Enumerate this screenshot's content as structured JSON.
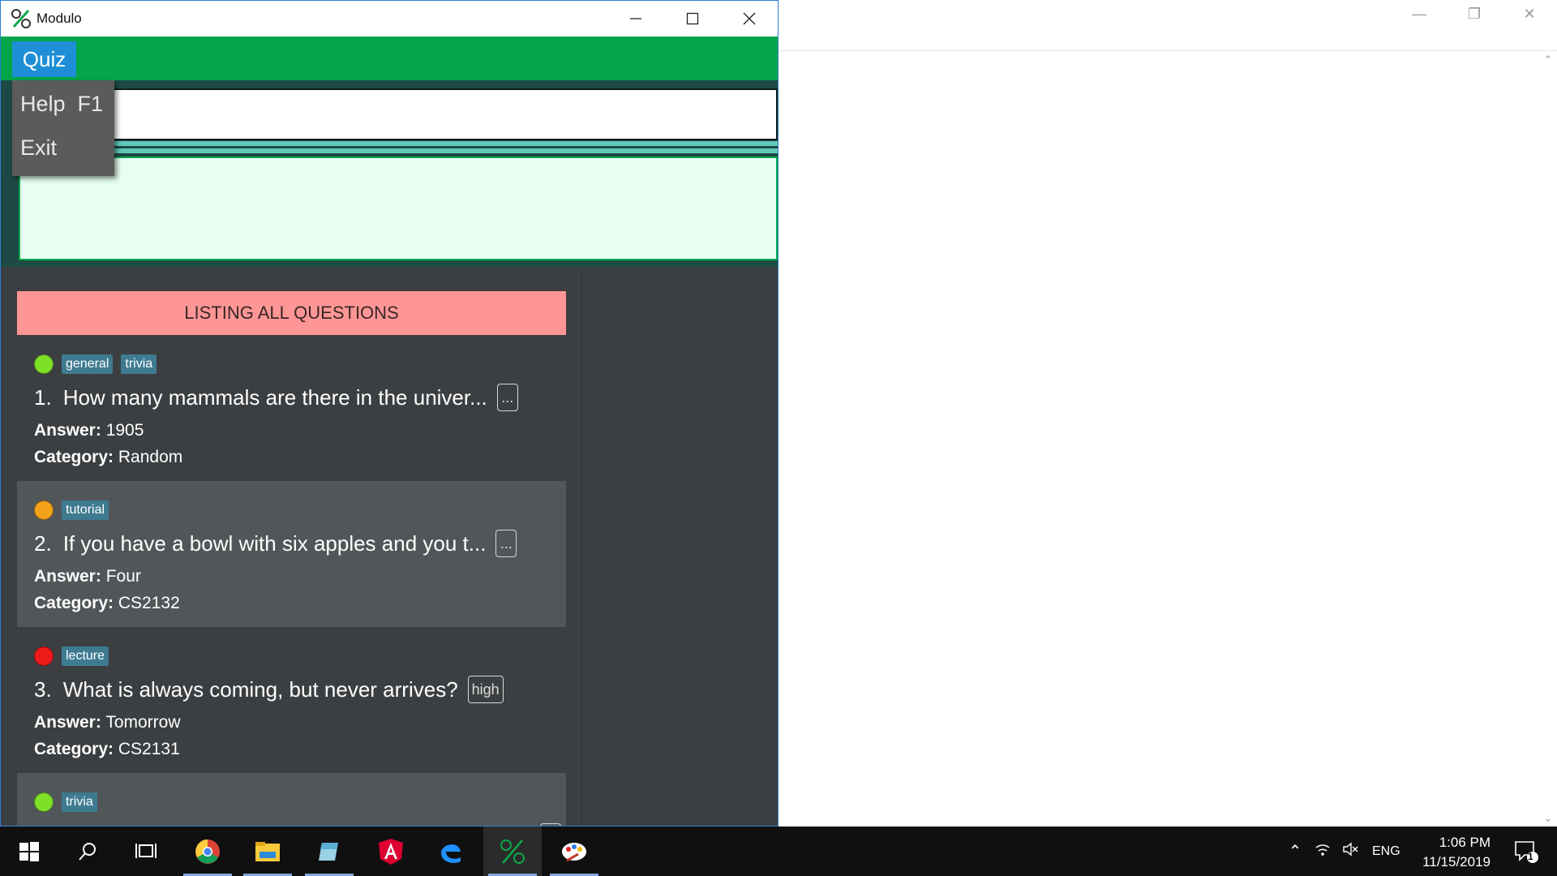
{
  "window": {
    "title": "Modulo",
    "minimize_icon": "minimize-icon",
    "maximize_icon": "maximize-icon",
    "close_icon": "close-icon"
  },
  "menubar": {
    "quiz_label": "Quiz"
  },
  "dropdown": {
    "items": [
      {
        "label": "Help",
        "shortcut": "F1"
      },
      {
        "label": "Exit"
      }
    ]
  },
  "list": {
    "header": "LISTING ALL QUESTIONS",
    "cards": [
      {
        "number": "1.",
        "difficulty_color": "#7fe02a",
        "tags": [
          "general",
          "trivia"
        ],
        "question": "How many mammals are there in the univer...",
        "button_label": "...",
        "answer_label": "Answer:",
        "answer": "1905",
        "category_label": "Category:",
        "category": "Random"
      },
      {
        "number": "2.",
        "difficulty_color": "#f4a21a",
        "tags": [
          "tutorial"
        ],
        "question": "If you have a bowl with six apples and you t...",
        "button_label": "...",
        "answer_label": "Answer:",
        "answer": "Four",
        "category_label": "Category:",
        "category": "CS2132"
      },
      {
        "number": "3.",
        "difficulty_color": "#ee1a1a",
        "tags": [
          "lecture"
        ],
        "question": "What is always coming, but never arrives?",
        "button_label": "high",
        "answer_label": "Answer:",
        "answer": "Tomorrow",
        "category_label": "Category:",
        "category": "CS2131"
      },
      {
        "number": "",
        "difficulty_color": "#7fe02a",
        "tags": [
          "trivia"
        ],
        "question": "",
        "button_label": "",
        "answer_label": "",
        "answer": "",
        "category_label": "",
        "category": ""
      }
    ]
  },
  "taskbar": {
    "apps": [
      "windows-start-icon",
      "search-icon",
      "task-view-icon",
      "chrome-icon",
      "file-explorer-icon",
      "notepad-icon",
      "angular-icon",
      "edge-icon",
      "modulo-icon",
      "paint-icon"
    ],
    "language": "ENG",
    "time": "1:06 PM",
    "date": "11/15/2019",
    "notification_count": "1"
  },
  "colors": {
    "menubar": "#05a64b",
    "quiz_menu_active": "#1e8fd6",
    "list_header": "#ff9696",
    "tag": "#3e7b91"
  }
}
